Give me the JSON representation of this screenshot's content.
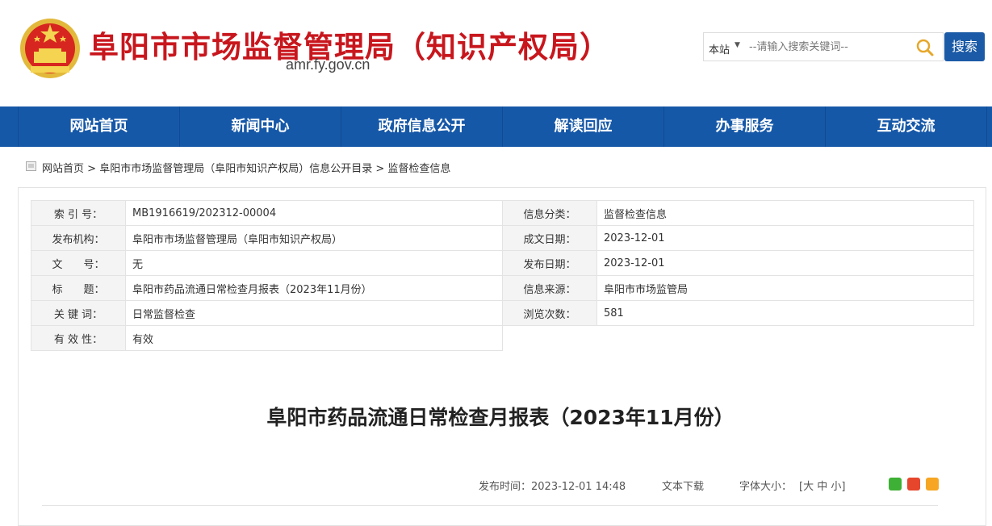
{
  "header": {
    "site_title": "阜阳市市场监督管理局（知识产权局）",
    "site_domain": "amr.fy.gov.cn",
    "emblem_icon": "national-emblem-icon",
    "brand_color": "#c8161d"
  },
  "search": {
    "scope": "本站",
    "placeholder": "--请输入搜索关键词--",
    "button_label": "搜索"
  },
  "nav": {
    "items": [
      "网站首页",
      "新闻中心",
      "政府信息公开",
      "解读回应",
      "办事服务",
      "互动交流"
    ],
    "color": "#1658a8"
  },
  "breadcrumb": {
    "items": [
      "网站首页",
      "阜阳市市场监督管理局（阜阳市知识产权局）信息公开目录",
      "监督检查信息"
    ],
    "separator": ">"
  },
  "info": {
    "index_label": "索 引 号：",
    "index_value": "MB1916619/202312-00004",
    "category_label": "信息分类：",
    "category_value": "监督检查信息",
    "publisher_label": "发布机构：",
    "publisher_value": "阜阳市市场监督管理局（阜阳市知识产权局）",
    "created_label": "成文日期：",
    "created_value": "2023-12-01",
    "docno_label": "文　　号：",
    "docno_value": "无",
    "pubdate_label": "发布日期：",
    "pubdate_value": "2023-12-01",
    "title_label": "标　　题：",
    "title_value": "阜阳市药品流通日常检查月报表（2023年11月份）",
    "source_label": "信息来源：",
    "source_value": "阜阳市市场监管局",
    "keywords_label": "关 键 词：",
    "keywords_value": "日常监督检查",
    "views_label": "浏览次数：",
    "views_value": "581",
    "validity_label": "有 效 性：",
    "validity_value": "有效"
  },
  "article": {
    "title": "阜阳市药品流通日常检查月报表（2023年11月份）",
    "publish_time": "发布时间：2023-12-01 14:48",
    "download": "文本下载",
    "font_size_label": "字体大小：",
    "font_size_options": "[大 中 小]"
  },
  "share": {
    "icons": [
      "wechat-icon",
      "weibo-icon",
      "qzone-icon"
    ],
    "colors": [
      "#3eb035",
      "#e6462c",
      "#f6a623"
    ]
  }
}
